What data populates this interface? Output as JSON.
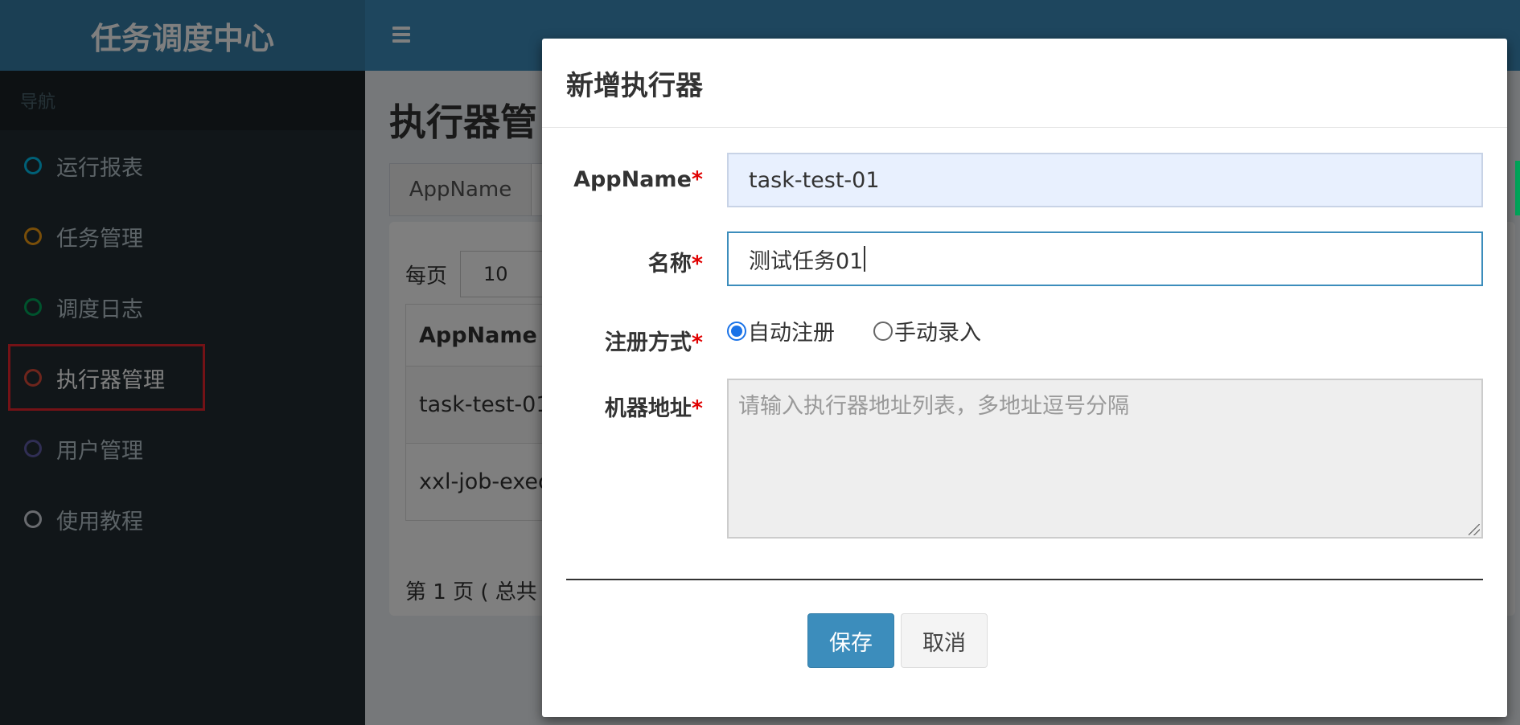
{
  "app": {
    "title": "任务调度中心"
  },
  "sidebar": {
    "header": "导航",
    "items": [
      {
        "label": "运行报表",
        "color": "#00c0ef"
      },
      {
        "label": "任务管理",
        "color": "#f39c12"
      },
      {
        "label": "调度日志",
        "color": "#00a65a"
      },
      {
        "label": "执行器管理",
        "color": "#dd4b39"
      },
      {
        "label": "用户管理",
        "color": "#605ca8"
      },
      {
        "label": "使用教程",
        "color": "#d2d6de"
      }
    ],
    "active_index": 3
  },
  "content": {
    "title": "执行器管",
    "search_addon": "AppName",
    "per_page_label": "每页",
    "per_page_value": "10",
    "table_header": "AppName",
    "rows": [
      "task-test-01",
      "xxl-job-exec"
    ],
    "page_info": "第 1 页 ( 总共"
  },
  "modal": {
    "title": "新增执行器",
    "appname_label": "AppName",
    "appname_value": "task-test-01",
    "name_label": "名称",
    "name_value": "测试任务01",
    "register_label": "注册方式",
    "register_options": [
      "自动注册",
      "手动录入"
    ],
    "register_selected": 0,
    "address_label": "机器地址",
    "address_placeholder": "请输入执行器地址列表，多地址逗号分隔",
    "required_mark": "*",
    "save_label": "保存",
    "cancel_label": "取消"
  },
  "colors": {
    "header_bg": "#3c8dbc",
    "logo_bg": "#367fa9",
    "sidebar_bg": "#222d32",
    "primary_button": "#3c8dbc",
    "highlight_box": "#e8242c"
  }
}
